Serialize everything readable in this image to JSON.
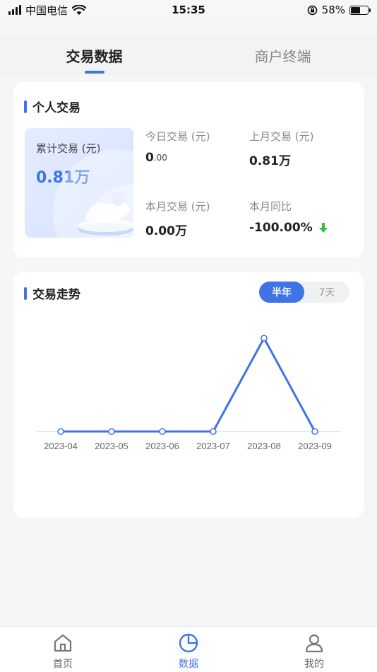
{
  "status_bar": {
    "carrier": "中国电信",
    "time": "15:35",
    "battery": "58%",
    "battery_level": 0.58
  },
  "top_tabs": [
    {
      "label": "交易数据",
      "active": true
    },
    {
      "label": "商户终端",
      "active": false
    }
  ],
  "personal": {
    "title": "个人交易",
    "total_label": "累计交易 (元)",
    "total_value": "0.81万",
    "today_label": "今日交易 (元)",
    "today_value_main": "0",
    "today_value_dec": ".00",
    "last_month_label": "上月交易 (元)",
    "last_month_value": "0.81万",
    "this_month_label": "本月交易 (元)",
    "this_month_value": "0.00万",
    "yoy_label": "本月同比",
    "yoy_value": "-100.00%"
  },
  "trend": {
    "title": "交易走势",
    "toggle": [
      {
        "label": "半年",
        "active": true
      },
      {
        "label": "7天",
        "active": false
      }
    ]
  },
  "chart_data": {
    "type": "line",
    "categories": [
      "2023-04",
      "2023-05",
      "2023-06",
      "2023-07",
      "2023-08",
      "2023-09"
    ],
    "values": [
      0,
      0,
      0,
      0,
      0.81,
      0
    ],
    "ylim": [
      0,
      0.81
    ],
    "grid": false,
    "color": "#3f73e6"
  },
  "bottom_nav": [
    {
      "label": "首页",
      "icon": "home-icon",
      "active": false
    },
    {
      "label": "数据",
      "icon": "pie-chart-icon",
      "active": true
    },
    {
      "label": "我的",
      "icon": "user-icon",
      "active": false
    }
  ],
  "colors": {
    "accent": "#3f73e6",
    "down_arrow": "#2fbf4a"
  }
}
